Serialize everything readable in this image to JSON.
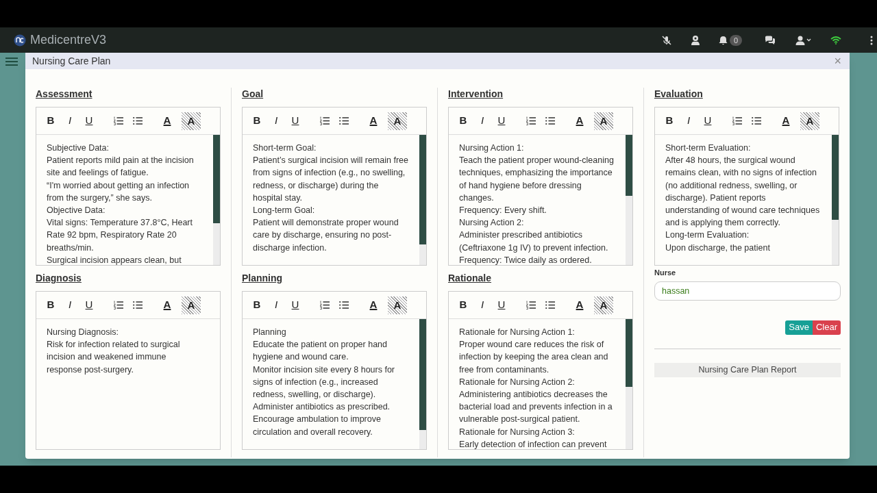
{
  "app_bar": {
    "title": "MedicentreV3",
    "notification_count": "0"
  },
  "modal": {
    "title": "Nursing Care Plan",
    "close_label": "×"
  },
  "columns": [
    {
      "sections": [
        {
          "title": "Assessment",
          "toolbar": [
            {
              "kind": "bold",
              "label": "B"
            },
            {
              "kind": "italic",
              "label": "I"
            },
            {
              "kind": "underline",
              "label": "U"
            },
            {
              "kind": "ordered-list"
            },
            {
              "kind": "bullet-list"
            },
            {
              "kind": "font-color",
              "label": "A"
            },
            {
              "kind": "highlight",
              "label": "A"
            }
          ],
          "lines": [
            "Subjective Data:",
            "Patient reports mild pain at the incision site and feelings of fatigue.",
            "“I'm worried about getting an infection from the surgery,” she says.",
            "Objective Data:",
            "Vital signs: Temperature 37.8°C, Heart Rate 92 bpm, Respiratory Rate 20 breaths/min.",
            "Surgical incision appears clean, but"
          ]
        },
        {
          "title": "Diagnosis",
          "toolbar": [
            {
              "kind": "bold",
              "label": "B"
            },
            {
              "kind": "italic",
              "label": "I"
            },
            {
              "kind": "underline",
              "label": "U"
            },
            {
              "kind": "ordered-list"
            },
            {
              "kind": "bullet-list"
            },
            {
              "kind": "font-color",
              "label": "A"
            },
            {
              "kind": "highlight",
              "label": "A"
            }
          ],
          "lines": [
            "Nursing Diagnosis:",
            "Risk for infection related to surgical incision and weakened immune response post-surgery."
          ]
        }
      ]
    },
    {
      "sections": [
        {
          "title": "Goal",
          "toolbar": [
            {
              "kind": "bold",
              "label": "B"
            },
            {
              "kind": "italic",
              "label": "I"
            },
            {
              "kind": "underline",
              "label": "U"
            },
            {
              "kind": "ordered-list"
            },
            {
              "kind": "bullet-list"
            },
            {
              "kind": "font-color",
              "label": "A"
            },
            {
              "kind": "highlight",
              "label": "A"
            }
          ],
          "lines": [
            "Short-term Goal:",
            "Patient’s surgical incision will remain free from signs of infection (e.g., no swelling, redness, or discharge) during the hospital stay.",
            "Long-term Goal:",
            "Patient will demonstrate proper wound care by discharge, ensuring no post-discharge infection."
          ]
        },
        {
          "title": "Planning",
          "toolbar": [
            {
              "kind": "bold",
              "label": "B"
            },
            {
              "kind": "italic",
              "label": "I"
            },
            {
              "kind": "underline",
              "label": "U"
            },
            {
              "kind": "ordered-list"
            },
            {
              "kind": "bullet-list"
            },
            {
              "kind": "font-color",
              "label": "A"
            },
            {
              "kind": "highlight",
              "label": "A"
            }
          ],
          "lines": [
            "Planning",
            "Educate the patient on proper hand hygiene and wound care.",
            "Monitor incision site every 8 hours for signs of infection (e.g., increased redness, swelling, or discharge).",
            "Administer antibiotics as prescribed.",
            "Encourage ambulation to improve circulation and overall recovery."
          ]
        }
      ]
    },
    {
      "sections": [
        {
          "title": "Intervention",
          "toolbar": [
            {
              "kind": "bold",
              "label": "B"
            },
            {
              "kind": "italic",
              "label": "I"
            },
            {
              "kind": "underline",
              "label": "U"
            },
            {
              "kind": "ordered-list"
            },
            {
              "kind": "bullet-list"
            },
            {
              "kind": "font-color",
              "label": "A"
            },
            {
              "kind": "highlight",
              "label": "A"
            }
          ],
          "lines": [
            "Nursing Action 1:",
            "Teach the patient proper wound-cleaning techniques, emphasizing the importance of hand hygiene before dressing changes.",
            "Frequency: Every shift.",
            "Nursing Action 2:",
            "Administer prescribed antibiotics (Ceftriaxone 1g IV) to prevent infection.",
            "Frequency: Twice daily as ordered."
          ]
        },
        {
          "title": "Rationale",
          "toolbar": [
            {
              "kind": "bold",
              "label": "B"
            },
            {
              "kind": "italic",
              "label": "I"
            },
            {
              "kind": "underline",
              "label": "U"
            },
            {
              "kind": "ordered-list"
            },
            {
              "kind": "bullet-list"
            },
            {
              "kind": "font-color",
              "label": "A"
            },
            {
              "kind": "highlight",
              "label": "A"
            }
          ],
          "lines": [
            "Rationale for Nursing Action 1:",
            "Proper wound care reduces the risk of infection by keeping the area clean and free from contaminants.",
            "Rationale for Nursing Action 2:",
            "Administering antibiotics decreases the bacterial load and prevents infection in a vulnerable post-surgical patient.",
            "Rationale for Nursing Action 3:",
            "Early detection of infection can prevent"
          ]
        }
      ]
    },
    {
      "sections": [
        {
          "title": "Evaluation",
          "toolbar": [
            {
              "kind": "bold",
              "label": "B"
            },
            {
              "kind": "italic",
              "label": "I"
            },
            {
              "kind": "underline",
              "label": "U"
            },
            {
              "kind": "ordered-list"
            },
            {
              "kind": "bullet-list"
            },
            {
              "kind": "font-color",
              "label": "A"
            },
            {
              "kind": "highlight",
              "label": "A"
            }
          ],
          "lines": [
            "Short-term Evaluation:",
            "After 48 hours, the surgical wound remains clean, with no signs of infection (no additional redness, swelling, or discharge). Patient reports understanding of wound care techniques and is applying them correctly.",
            "Long-term Evaluation:",
            "Upon discharge, the patient"
          ]
        }
      ],
      "nurse": {
        "label": "Nurse",
        "value": "hassan"
      },
      "buttons": [
        {
          "kind": "save",
          "label": "Save"
        },
        {
          "kind": "clear",
          "label": "Clear"
        }
      ],
      "report_label": "Nursing Care Plan Report"
    }
  ]
}
